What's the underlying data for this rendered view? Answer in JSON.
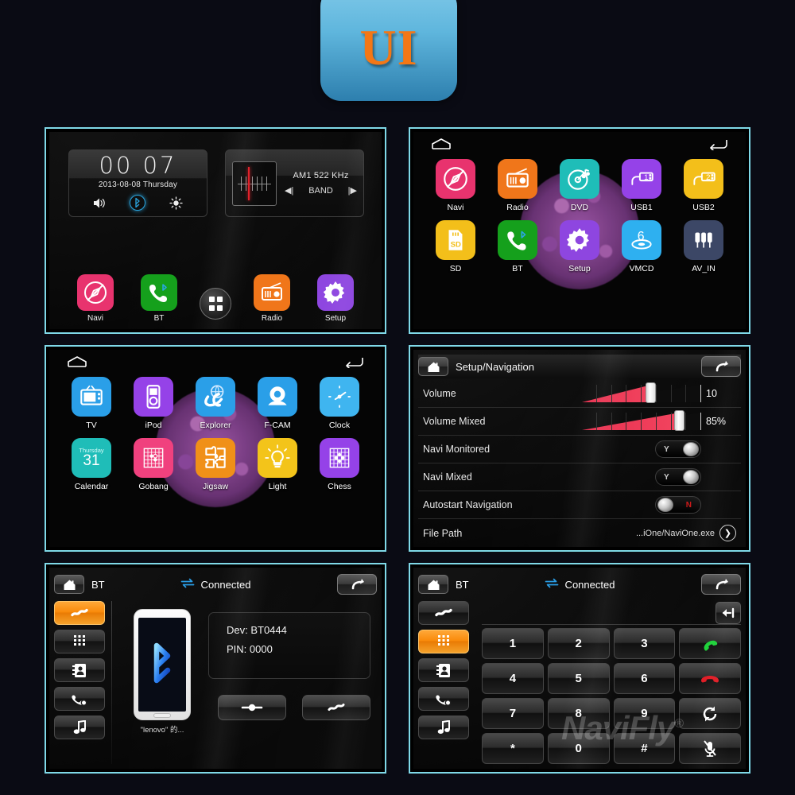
{
  "logo": {
    "text": "UI"
  },
  "panel_home": {
    "clock": {
      "time": "00 07",
      "date": "2013-08-08  Thursday",
      "icons": [
        "volume-icon",
        "bluetooth-icon",
        "brightness-icon"
      ]
    },
    "radio": {
      "frequency": "AM1 522 KHz",
      "band_label": "BAND",
      "prev_icon": "prev-track-icon",
      "next_icon": "next-track-icon"
    },
    "dock": [
      {
        "label": "Navi",
        "icon": "navi-icon",
        "color": "#e8336e"
      },
      {
        "label": "BT",
        "icon": "bt-phone-icon",
        "color": "#15a01c"
      },
      {
        "label": "",
        "icon": "all-apps-icon",
        "color": "#2a2a2a"
      },
      {
        "label": "Radio",
        "icon": "radio-icon",
        "color": "#f0761a"
      },
      {
        "label": "Setup",
        "icon": "gear-icon",
        "color": "#8e46e0"
      }
    ]
  },
  "panel_apps1": {
    "home_icon": "home-outline-icon",
    "back_icon": "back-arrow-icon",
    "rows": [
      [
        {
          "label": "Navi",
          "icon": "navi-icon",
          "color": "#e8336e"
        },
        {
          "label": "Radio",
          "icon": "radio-icon",
          "color": "#f0761a"
        },
        {
          "label": "DVD",
          "icon": "dvd-icon",
          "color": "#1fbdb8"
        },
        {
          "label": "USB1",
          "icon": "usb1-icon",
          "color": "#9542e8"
        },
        {
          "label": "USB2",
          "icon": "usb2-icon",
          "color": "#f3bf1a"
        }
      ],
      [
        {
          "label": "SD",
          "icon": "sd-card-icon",
          "color": "#f3bf1a"
        },
        {
          "label": "BT",
          "icon": "bt-phone-icon",
          "color": "#15a01c"
        },
        {
          "label": "Setup",
          "icon": "gear-icon",
          "color": "#8e46e0"
        },
        {
          "label": "VMCD",
          "icon": "vmcd-icon",
          "color": "#2eb0f0"
        },
        {
          "label": "AV_IN",
          "icon": "av-in-icon",
          "color": "#3c4766"
        }
      ]
    ]
  },
  "panel_apps2": {
    "home_icon": "home-outline-icon",
    "back_icon": "back-arrow-icon",
    "rows": [
      [
        {
          "label": "TV",
          "icon": "tv-icon",
          "color": "#2a9fe8"
        },
        {
          "label": "iPod",
          "icon": "ipod-icon",
          "color": "#9542e8"
        },
        {
          "label": "Explorer",
          "icon": "explorer-icon",
          "color": "#2a9fe8"
        },
        {
          "label": "F-CAM",
          "icon": "camera-icon",
          "color": "#2a9fe8"
        },
        {
          "label": "Clock",
          "icon": "clock-icon",
          "color": "#3fb5f0"
        }
      ],
      [
        {
          "label": "Calendar",
          "icon": "calendar-icon",
          "color": "#1fbdb8",
          "day_name": "Thursday",
          "day_num": "31"
        },
        {
          "label": "Gobang",
          "icon": "gobang-icon",
          "color": "#f0417e"
        },
        {
          "label": "Jigsaw",
          "icon": "jigsaw-icon",
          "color": "#f09018"
        },
        {
          "label": "Light",
          "icon": "light-bulb-icon",
          "color": "#f3c41a"
        },
        {
          "label": "Chess",
          "icon": "chess-icon",
          "color": "#9542e8"
        }
      ]
    ]
  },
  "panel_setup": {
    "home_icon": "home-icon",
    "title": "Setup/Navigation",
    "back_icon": "back-arrow-icon",
    "rows": [
      {
        "label": "Volume",
        "type": "slider",
        "value": "10",
        "percent": 58
      },
      {
        "label": "Volume Mixed",
        "type": "slider",
        "value": "85%",
        "percent": 82
      },
      {
        "label": "Navi Monitored",
        "type": "toggle",
        "state": "Y",
        "on": true
      },
      {
        "label": "Navi Mixed",
        "type": "toggle",
        "state": "Y",
        "on": true
      },
      {
        "label": "Autostart Navigation",
        "type": "toggle",
        "state": "N",
        "on": false
      },
      {
        "label": "File Path",
        "type": "path",
        "value": "...iOne/NaviOne.exe",
        "chevron": "chevron-right-icon"
      }
    ]
  },
  "panel_bt_pair": {
    "home_icon": "home-icon",
    "name": "BT",
    "status": "Connected",
    "status_icon": "sync-arrows-icon",
    "back_icon": "back-arrow-icon",
    "sidebar": [
      {
        "icon": "bt-link-icon",
        "active": true
      },
      {
        "icon": "keypad-icon",
        "active": false
      },
      {
        "icon": "contacts-icon",
        "active": false
      },
      {
        "icon": "call-history-icon",
        "active": false
      },
      {
        "icon": "music-note-icon",
        "active": false
      }
    ],
    "phone_icon": "bluetooth-logo-icon",
    "phone_caption": "\"lenovo\" 的...",
    "device": "Dev: BT0444",
    "pin": "PIN: 0000",
    "actions": [
      {
        "icon": "bt-unlink-icon"
      },
      {
        "icon": "bt-link-icon"
      }
    ]
  },
  "panel_bt_dial": {
    "home_icon": "home-icon",
    "name": "BT",
    "status": "Connected",
    "status_icon": "sync-arrows-icon",
    "back_icon": "back-arrow-icon",
    "sidebar": [
      {
        "icon": "bt-link-icon",
        "active": false
      },
      {
        "icon": "keypad-icon",
        "active": true
      },
      {
        "icon": "contacts-icon",
        "active": false
      },
      {
        "icon": "call-history-icon",
        "active": false
      },
      {
        "icon": "music-note-icon",
        "active": false
      }
    ],
    "number_input": "",
    "delete_icon": "backspace-icon",
    "keys": [
      {
        "label": "1"
      },
      {
        "label": "2"
      },
      {
        "label": "3"
      },
      {
        "icon": "call-answer-icon"
      },
      {
        "label": "4"
      },
      {
        "label": "5"
      },
      {
        "label": "6"
      },
      {
        "icon": "call-end-icon"
      },
      {
        "label": "7"
      },
      {
        "label": "8"
      },
      {
        "label": "9"
      },
      {
        "icon": "call-transfer-icon"
      },
      {
        "label": "*"
      },
      {
        "label": "0"
      },
      {
        "label": "#"
      },
      {
        "icon": "mic-mute-icon"
      }
    ],
    "watermark": "NaviFly",
    "watermark_mark": "®"
  },
  "colors": {
    "background": "#0a0b14",
    "panel_border": "#7fd9e8",
    "accent_orange": "#f98a0b",
    "slider_red": "#e8304f",
    "status_blue": "#2a9fe8"
  }
}
